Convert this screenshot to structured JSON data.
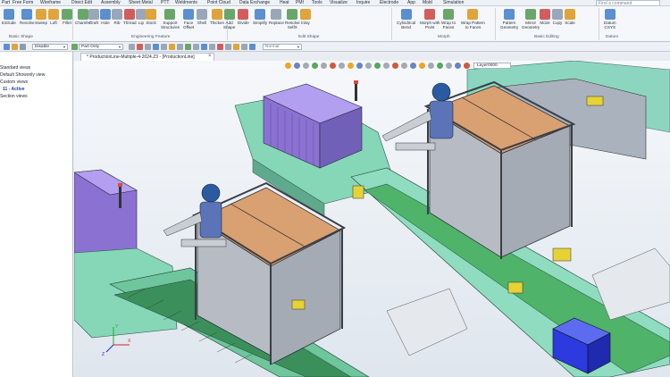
{
  "menu_tabs": [
    "Part",
    "Free Form",
    "Wireframe",
    "Direct Edit",
    "Assembly",
    "Sheet Metal",
    "PTT",
    "Weldments",
    "Point Cloud",
    "Data Exchange",
    "Heat",
    "PMI",
    "Tools",
    "Visualize",
    "Inquire",
    "Electrode",
    "App",
    "Mold",
    "Simulation"
  ],
  "command_search": {
    "placeholder": "Find a command"
  },
  "ribbon": {
    "buttons": [
      "Extrude",
      "Revolve",
      "Sweep",
      "Loft",
      "Fillet",
      "Chamfer",
      "Draft",
      "Hole",
      "Rib",
      "Thread",
      "Lip",
      "Stock",
      "Support\nStructures",
      "Face\nOffset",
      "Shell",
      "Thicken",
      "Add\nShape",
      "Divide",
      "Simplify",
      "Replace",
      "Resolve\nSelfX",
      "Inlay",
      "Cylindrical\nBend",
      "Morph with\nPoint",
      "Wrap to\nFaces",
      "Wrap Pattern\nto Faces",
      "Pattern\nGeometry",
      "Mirror\nGeometry",
      "Move",
      "Copy",
      "Scale",
      "Datum\nCSYS"
    ],
    "groups": [
      "Basic Shape",
      "Engineering Feature",
      "Edit Shape",
      "Morph",
      "Basic Editing",
      "Datum"
    ]
  },
  "toolbar": {
    "combo1": "Disable",
    "combo2": "Part Only",
    "combo3": "Normal"
  },
  "tree": {
    "items": [
      "Standard views",
      "Default Showonly view",
      "Custom views",
      "11 - Active",
      "Section views"
    ]
  },
  "document": {
    "tab_title": "* ProductionLine-Multiple-4-2024.Z3 - [ProductionLine]",
    "close": "×"
  },
  "viewport": {
    "layer": "Layer0000",
    "axes": [
      "X",
      "Y",
      "Z"
    ]
  },
  "colors": {
    "frame_gray": "#b9bdc3",
    "top_panel": "#d79b6d",
    "purple_box": "#9a7fd6",
    "conveyor_teal": "#7fd0b4",
    "belt_green": "#4fb36a",
    "worker_blue": "#2a5aa0",
    "blue_block": "#2d3ae0",
    "yellow_parts": "#e7d236"
  }
}
